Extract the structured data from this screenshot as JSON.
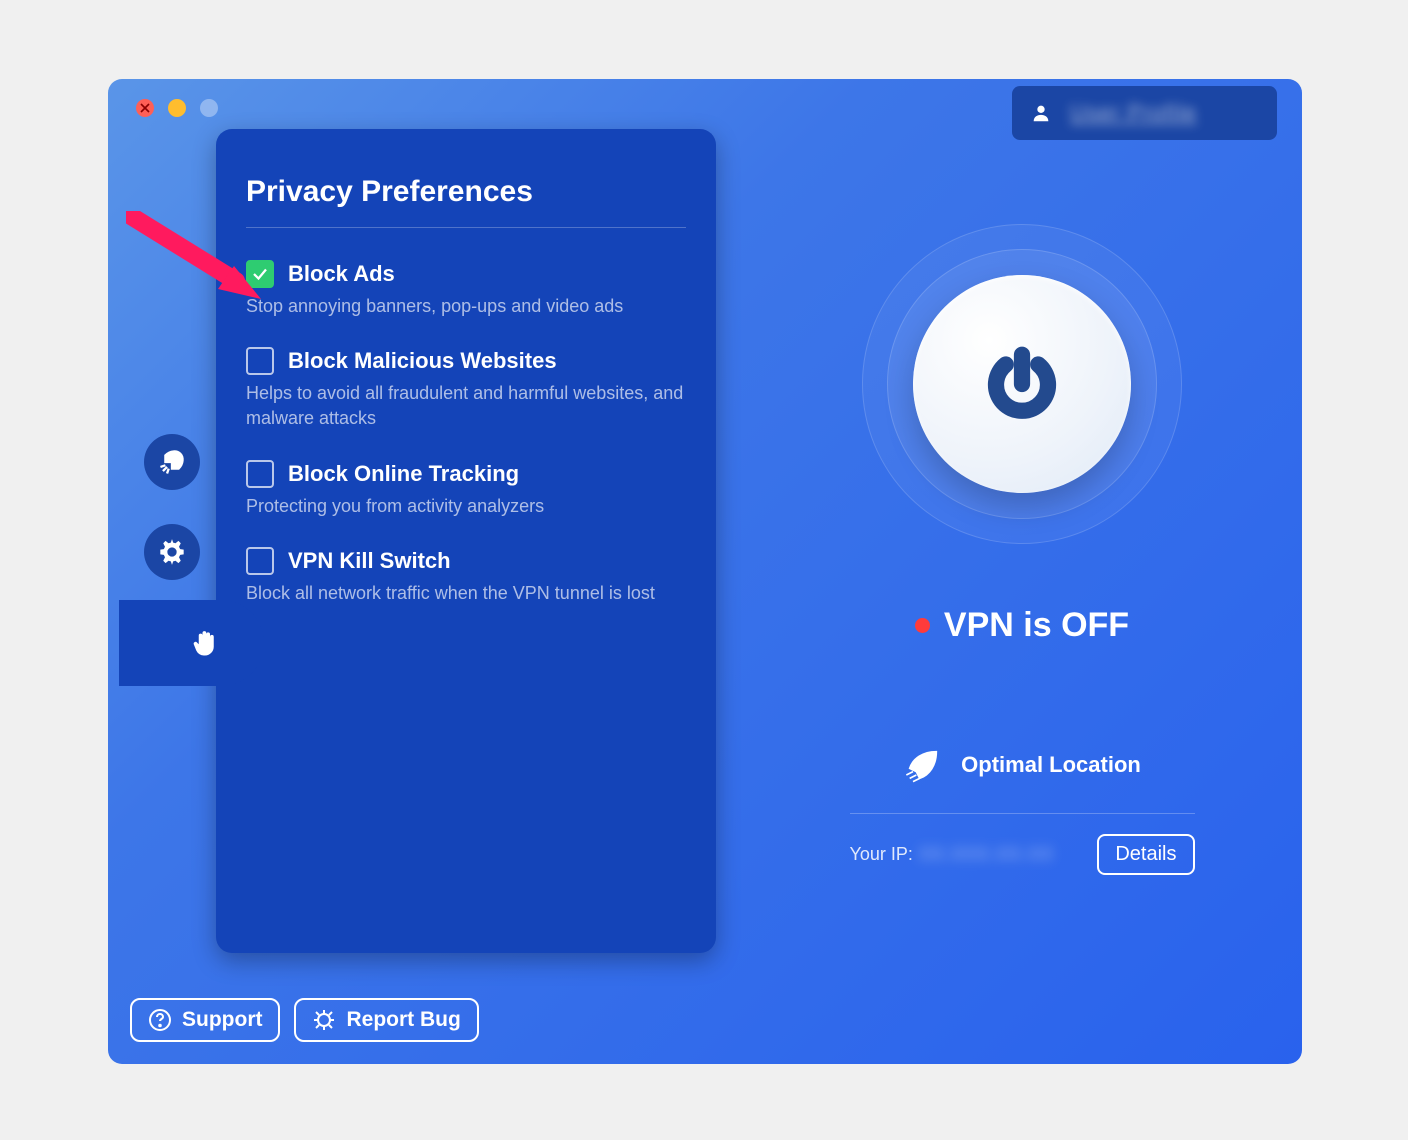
{
  "account_label": "User Profile",
  "sidebar": {
    "items": [
      {
        "name": "connection",
        "icon": "rocket"
      },
      {
        "name": "settings",
        "icon": "gear"
      },
      {
        "name": "security",
        "icon": "lock"
      },
      {
        "name": "privacy",
        "icon": "hand",
        "active": true
      }
    ]
  },
  "panel": {
    "title": "Privacy Preferences",
    "preferences": [
      {
        "title": "Block Ads",
        "description": "Stop annoying banners, pop-ups and video ads",
        "checked": true
      },
      {
        "title": "Block Malicious Websites",
        "description": "Helps to avoid all fraudulent and harmful websites, and malware attacks",
        "checked": false
      },
      {
        "title": "Block Online Tracking",
        "description": "Protecting you from activity analyzers",
        "checked": false
      },
      {
        "title": "VPN Kill Switch",
        "description": "Block all network traffic when the VPN tunnel is lost",
        "checked": false
      }
    ]
  },
  "status": {
    "text": "VPN is OFF",
    "color": "#ff3b3b"
  },
  "location": {
    "label": "Optimal Location",
    "ip_label": "Your IP:",
    "ip_value": "XX.XXX.XX.XX",
    "details_label": "Details"
  },
  "footer": {
    "support_label": "Support",
    "report_bug_label": "Report Bug"
  }
}
